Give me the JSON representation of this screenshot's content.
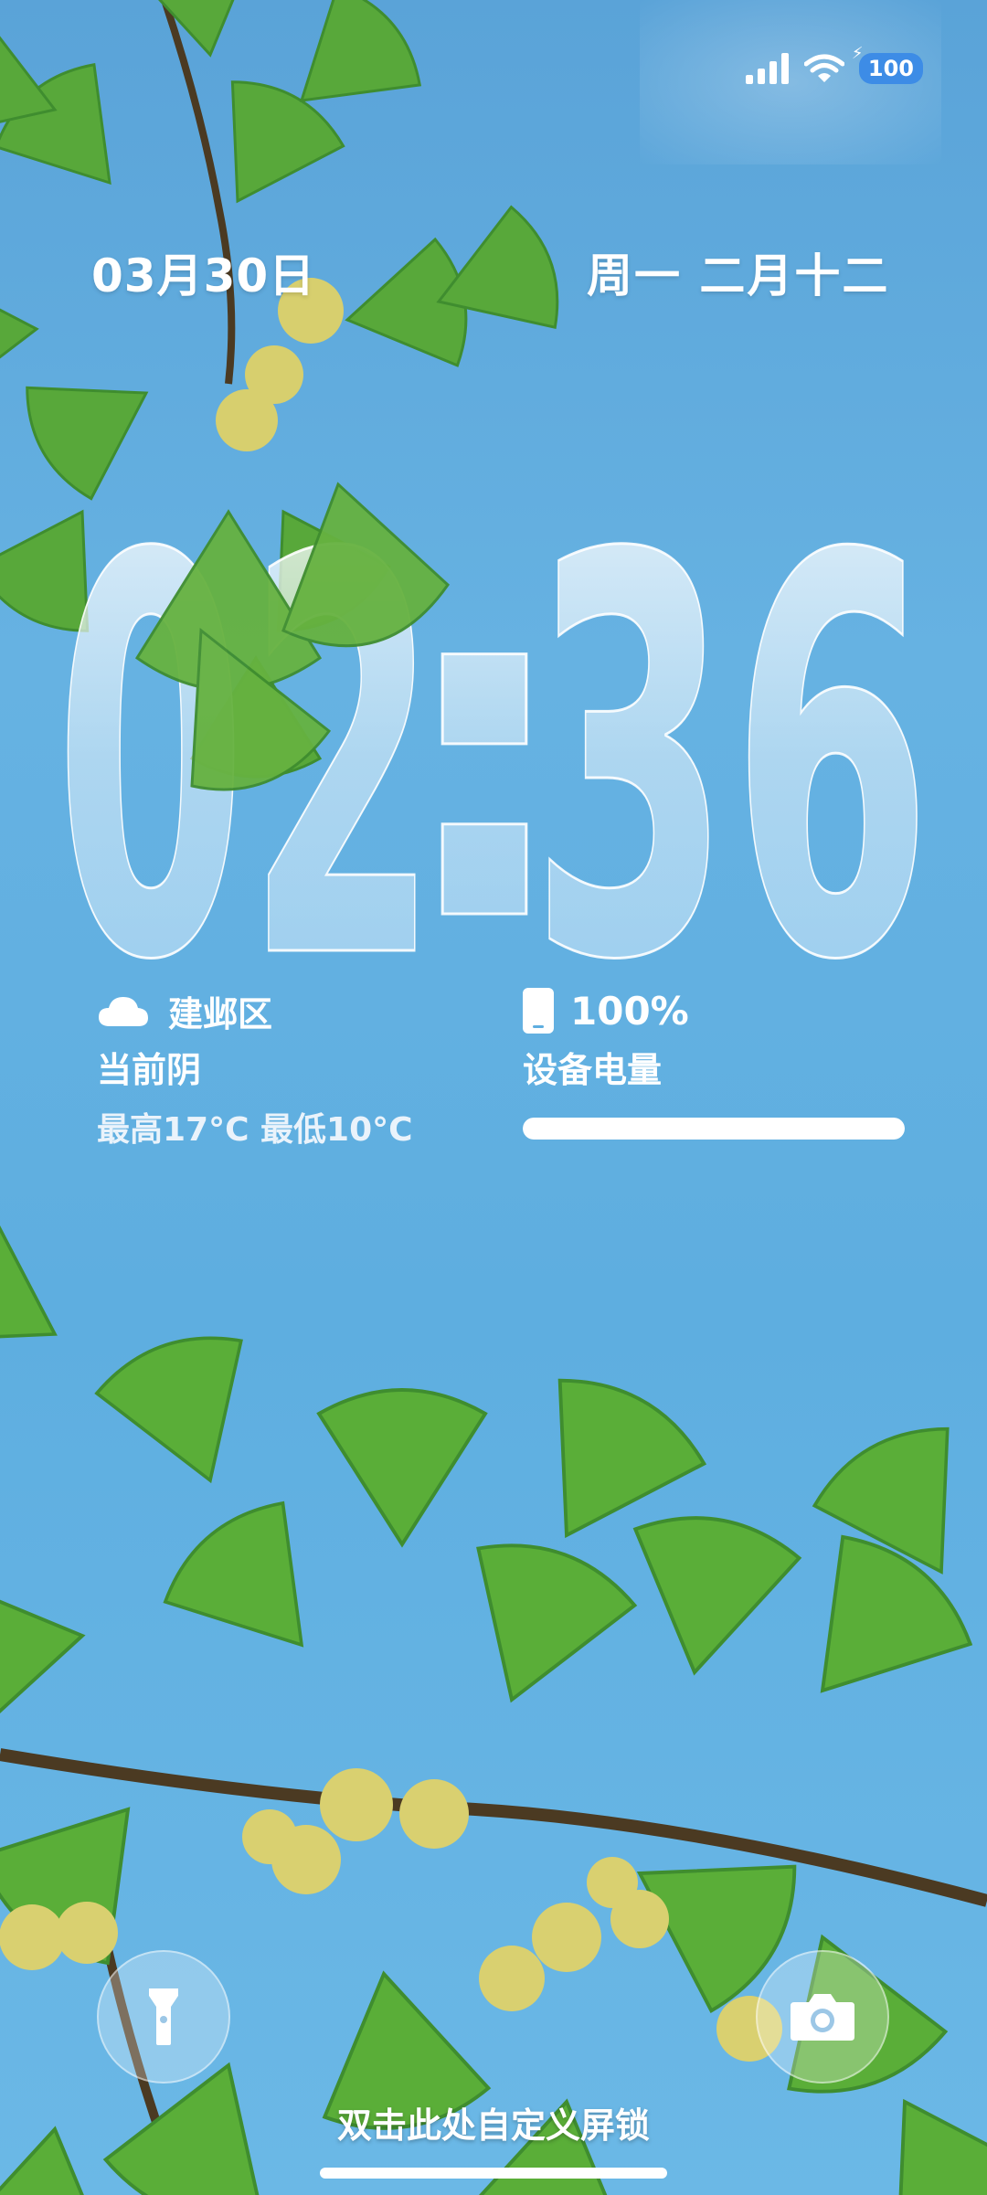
{
  "status_bar": {
    "battery_level": "100",
    "icons": [
      "signal-icon",
      "wifi-icon",
      "charging-icon",
      "battery-icon"
    ]
  },
  "date": {
    "left": "03月30日",
    "right": "周一 二月十二"
  },
  "clock": {
    "hours": "02",
    "minutes": "36",
    "separator": ":"
  },
  "weather": {
    "icon": "cloud-icon",
    "location": "建邺区",
    "condition": "当前阴",
    "range": "最高17°C 最低10°C"
  },
  "battery_widget": {
    "icon": "phone-icon",
    "percent_text": "100%",
    "label": "设备电量",
    "level": 1.0
  },
  "bottom": {
    "flashlight_icon": "flashlight-icon",
    "camera_icon": "camera-icon",
    "hint": "双击此处自定义屏锁"
  },
  "colors": {
    "sky": "#5eaee0",
    "leaf_dark": "#3f8d2f",
    "leaf_light": "#7fc24a",
    "fruit": "#d7cf6e",
    "battery_pill": "#3d8ce6"
  }
}
